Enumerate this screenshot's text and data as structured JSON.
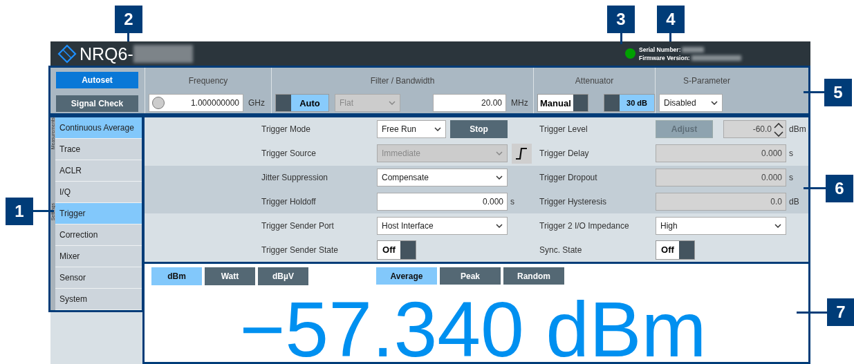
{
  "callouts": [
    {
      "number": "1"
    },
    {
      "number": "2"
    },
    {
      "number": "3"
    },
    {
      "number": "4"
    },
    {
      "number": "5"
    },
    {
      "number": "6"
    },
    {
      "number": "7"
    }
  ],
  "header": {
    "title": "NRQ6-",
    "serial_label": "Serial Number:",
    "firmware_label": "Firmware Version:"
  },
  "toolbar": {
    "buttons": [
      {
        "label": "Autoset",
        "selected": true
      },
      {
        "label": "Signal Check",
        "selected": false
      }
    ],
    "frequency": {
      "title": "Frequency",
      "value": "1.000000000",
      "unit": "GHz"
    },
    "filter": {
      "title": "Filter / Bandwidth",
      "toggle": {
        "label": "Auto",
        "on": true
      },
      "filter": {
        "value": "Flat",
        "disabled": true
      },
      "bandwidth": "20.00",
      "unit": "MHz"
    },
    "attenuator": {
      "title": "Attenuator",
      "mode": {
        "label": "Manual",
        "on": false
      },
      "value": {
        "label": "30 dB",
        "on": true
      }
    },
    "s_parameter": {
      "title": "S-Parameter",
      "value": "Disabled"
    }
  },
  "sidebar": {
    "sections": [
      {
        "title": "Measurements",
        "items": [
          {
            "label": "Continuous Average",
            "selected": true
          },
          {
            "label": "Trace",
            "selected": false
          },
          {
            "label": "ACLR",
            "selected": false
          },
          {
            "label": "I/Q",
            "selected": false
          }
        ]
      },
      {
        "title": "Settings",
        "items": [
          {
            "label": "Trigger",
            "selected": true
          },
          {
            "label": "Correction",
            "selected": false
          },
          {
            "label": "Mixer",
            "selected": false
          },
          {
            "label": "Sensor",
            "selected": false
          },
          {
            "label": "System",
            "selected": false
          }
        ]
      }
    ]
  },
  "settings": {
    "rows": [
      {
        "shaded": false,
        "fields": [
          {
            "label": "Trigger Mode",
            "controls": [
              {
                "kind": "select",
                "value": "Free Run",
                "disabled": false
              },
              {
                "kind": "button",
                "value": "Stop",
                "disabled": false
              }
            ]
          },
          {
            "label": "Trigger Level",
            "controls": [
              {
                "kind": "button",
                "value": "Adjust",
                "disabled": true
              },
              {
                "kind": "spin",
                "value": "-60.0",
                "disabled": true
              }
            ],
            "unit": "dBm"
          }
        ]
      },
      {
        "shaded": false,
        "fields": [
          {
            "label": "Trigger Source",
            "controls": [
              {
                "kind": "select",
                "value": "Immediate",
                "disabled": true
              },
              {
                "kind": "slope"
              }
            ]
          },
          {
            "label": "Trigger Delay",
            "controls": [
              {
                "kind": "number",
                "value": "0.000",
                "disabled": true
              }
            ],
            "unit": "s"
          }
        ]
      },
      {
        "shaded": true,
        "fields": [
          {
            "label": "Jitter Suppression",
            "controls": [
              {
                "kind": "select",
                "value": "Compensate",
                "disabled": false
              }
            ]
          },
          {
            "label": "Trigger Dropout",
            "controls": [
              {
                "kind": "number",
                "value": "0.000",
                "disabled": true
              }
            ],
            "unit": "s"
          }
        ]
      },
      {
        "shaded": true,
        "fields": [
          {
            "label": "Trigger Holdoff",
            "controls": [
              {
                "kind": "number",
                "value": "0.000",
                "disabled": false
              }
            ],
            "unit": "s"
          },
          {
            "label": "Trigger Hysteresis",
            "controls": [
              {
                "kind": "number",
                "value": "0.0",
                "disabled": true
              }
            ],
            "unit": "dB"
          }
        ]
      },
      {
        "shaded": false,
        "fields": [
          {
            "label": "Trigger Sender Port",
            "controls": [
              {
                "kind": "select",
                "value": "Host Interface",
                "disabled": false
              }
            ]
          },
          {
            "label": "Trigger 2 I/O Impedance",
            "controls": [
              {
                "kind": "select",
                "value": "High",
                "disabled": false
              }
            ]
          }
        ]
      },
      {
        "shaded": false,
        "fields": [
          {
            "label": "Trigger Sender State",
            "controls": [
              {
                "kind": "toggle",
                "value": "Off",
                "on": false
              }
            ]
          },
          {
            "label": "Sync. State",
            "controls": [
              {
                "kind": "toggle",
                "value": "Off",
                "on": false
              }
            ]
          }
        ]
      }
    ]
  },
  "measurement": {
    "units": [
      {
        "label": "dBm",
        "selected": true
      },
      {
        "label": "Watt",
        "selected": false
      },
      {
        "label": "dBµV",
        "selected": false
      }
    ],
    "modes": [
      {
        "label": "Average",
        "selected": true
      },
      {
        "label": "Peak",
        "selected": false
      },
      {
        "label": "Random",
        "selected": false
      }
    ],
    "reading": "−57.340 dBm"
  }
}
